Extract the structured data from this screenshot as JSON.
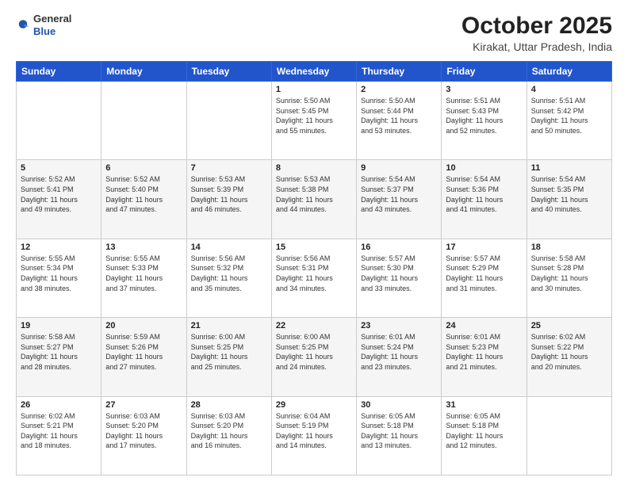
{
  "header": {
    "logo_line1": "General",
    "logo_line2": "Blue",
    "month": "October 2025",
    "location": "Kirakat, Uttar Pradesh, India"
  },
  "weekdays": [
    "Sunday",
    "Monday",
    "Tuesday",
    "Wednesday",
    "Thursday",
    "Friday",
    "Saturday"
  ],
  "weeks": [
    [
      {
        "day": "",
        "info": ""
      },
      {
        "day": "",
        "info": ""
      },
      {
        "day": "",
        "info": ""
      },
      {
        "day": "1",
        "info": "Sunrise: 5:50 AM\nSunset: 5:45 PM\nDaylight: 11 hours\nand 55 minutes."
      },
      {
        "day": "2",
        "info": "Sunrise: 5:50 AM\nSunset: 5:44 PM\nDaylight: 11 hours\nand 53 minutes."
      },
      {
        "day": "3",
        "info": "Sunrise: 5:51 AM\nSunset: 5:43 PM\nDaylight: 11 hours\nand 52 minutes."
      },
      {
        "day": "4",
        "info": "Sunrise: 5:51 AM\nSunset: 5:42 PM\nDaylight: 11 hours\nand 50 minutes."
      }
    ],
    [
      {
        "day": "5",
        "info": "Sunrise: 5:52 AM\nSunset: 5:41 PM\nDaylight: 11 hours\nand 49 minutes."
      },
      {
        "day": "6",
        "info": "Sunrise: 5:52 AM\nSunset: 5:40 PM\nDaylight: 11 hours\nand 47 minutes."
      },
      {
        "day": "7",
        "info": "Sunrise: 5:53 AM\nSunset: 5:39 PM\nDaylight: 11 hours\nand 46 minutes."
      },
      {
        "day": "8",
        "info": "Sunrise: 5:53 AM\nSunset: 5:38 PM\nDaylight: 11 hours\nand 44 minutes."
      },
      {
        "day": "9",
        "info": "Sunrise: 5:54 AM\nSunset: 5:37 PM\nDaylight: 11 hours\nand 43 minutes."
      },
      {
        "day": "10",
        "info": "Sunrise: 5:54 AM\nSunset: 5:36 PM\nDaylight: 11 hours\nand 41 minutes."
      },
      {
        "day": "11",
        "info": "Sunrise: 5:54 AM\nSunset: 5:35 PM\nDaylight: 11 hours\nand 40 minutes."
      }
    ],
    [
      {
        "day": "12",
        "info": "Sunrise: 5:55 AM\nSunset: 5:34 PM\nDaylight: 11 hours\nand 38 minutes."
      },
      {
        "day": "13",
        "info": "Sunrise: 5:55 AM\nSunset: 5:33 PM\nDaylight: 11 hours\nand 37 minutes."
      },
      {
        "day": "14",
        "info": "Sunrise: 5:56 AM\nSunset: 5:32 PM\nDaylight: 11 hours\nand 35 minutes."
      },
      {
        "day": "15",
        "info": "Sunrise: 5:56 AM\nSunset: 5:31 PM\nDaylight: 11 hours\nand 34 minutes."
      },
      {
        "day": "16",
        "info": "Sunrise: 5:57 AM\nSunset: 5:30 PM\nDaylight: 11 hours\nand 33 minutes."
      },
      {
        "day": "17",
        "info": "Sunrise: 5:57 AM\nSunset: 5:29 PM\nDaylight: 11 hours\nand 31 minutes."
      },
      {
        "day": "18",
        "info": "Sunrise: 5:58 AM\nSunset: 5:28 PM\nDaylight: 11 hours\nand 30 minutes."
      }
    ],
    [
      {
        "day": "19",
        "info": "Sunrise: 5:58 AM\nSunset: 5:27 PM\nDaylight: 11 hours\nand 28 minutes."
      },
      {
        "day": "20",
        "info": "Sunrise: 5:59 AM\nSunset: 5:26 PM\nDaylight: 11 hours\nand 27 minutes."
      },
      {
        "day": "21",
        "info": "Sunrise: 6:00 AM\nSunset: 5:25 PM\nDaylight: 11 hours\nand 25 minutes."
      },
      {
        "day": "22",
        "info": "Sunrise: 6:00 AM\nSunset: 5:25 PM\nDaylight: 11 hours\nand 24 minutes."
      },
      {
        "day": "23",
        "info": "Sunrise: 6:01 AM\nSunset: 5:24 PM\nDaylight: 11 hours\nand 23 minutes."
      },
      {
        "day": "24",
        "info": "Sunrise: 6:01 AM\nSunset: 5:23 PM\nDaylight: 11 hours\nand 21 minutes."
      },
      {
        "day": "25",
        "info": "Sunrise: 6:02 AM\nSunset: 5:22 PM\nDaylight: 11 hours\nand 20 minutes."
      }
    ],
    [
      {
        "day": "26",
        "info": "Sunrise: 6:02 AM\nSunset: 5:21 PM\nDaylight: 11 hours\nand 18 minutes."
      },
      {
        "day": "27",
        "info": "Sunrise: 6:03 AM\nSunset: 5:20 PM\nDaylight: 11 hours\nand 17 minutes."
      },
      {
        "day": "28",
        "info": "Sunrise: 6:03 AM\nSunset: 5:20 PM\nDaylight: 11 hours\nand 16 minutes."
      },
      {
        "day": "29",
        "info": "Sunrise: 6:04 AM\nSunset: 5:19 PM\nDaylight: 11 hours\nand 14 minutes."
      },
      {
        "day": "30",
        "info": "Sunrise: 6:05 AM\nSunset: 5:18 PM\nDaylight: 11 hours\nand 13 minutes."
      },
      {
        "day": "31",
        "info": "Sunrise: 6:05 AM\nSunset: 5:18 PM\nDaylight: 11 hours\nand 12 minutes."
      },
      {
        "day": "",
        "info": ""
      }
    ]
  ]
}
